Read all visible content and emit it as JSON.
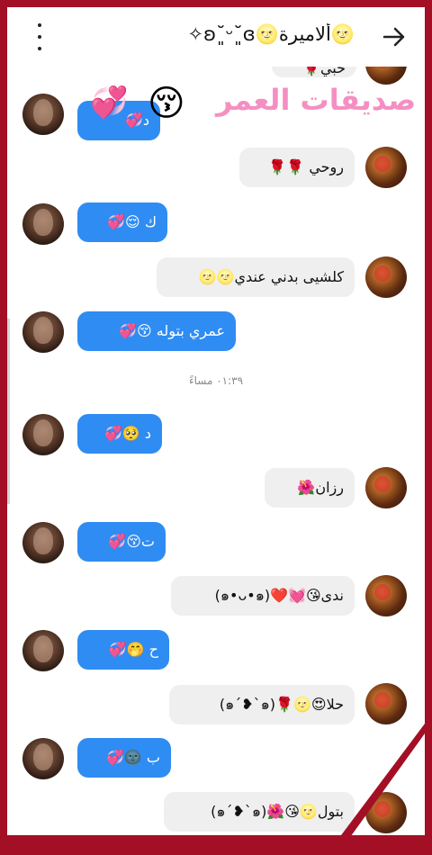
{
  "header": {
    "title": "🌝ألاميرة🌝ʚ˘͈ᵕ˘͈ɞ✧",
    "back_icon": "arrow-right-icon",
    "menu_icon": "more-vertical-icon"
  },
  "overlay": {
    "text": "صديقات العمر",
    "emoji_1": "😚",
    "emoji_2": "💞"
  },
  "messages": [
    {
      "side": "recv",
      "text": "حبي🌹"
    },
    {
      "side": "sent",
      "text": "د💞"
    },
    {
      "side": "recv",
      "text": "روحي 🌹🌹"
    },
    {
      "side": "sent",
      "text": "ك 😌💞"
    },
    {
      "side": "recv",
      "text": "كلشيى بدني عندي🌝🌝"
    },
    {
      "side": "sent",
      "text": "ع‍مري بتوله 😚💞"
    },
    {
      "side": "sent",
      "text": "د 🥺💞"
    },
    {
      "side": "recv",
      "text": "رزان🌺"
    },
    {
      "side": "sent",
      "text": "ت😚💞"
    },
    {
      "side": "recv",
      "text": "ندى😘💓❤️(๑•ᴗ•๑)"
    },
    {
      "side": "sent",
      "text": "ح 🤭💞"
    },
    {
      "side": "recv",
      "text": "حلا😍🌝🌹(๑ˊ❥ˋ๑)"
    },
    {
      "side": "sent",
      "text": "ب 🌚💞"
    },
    {
      "side": "recv",
      "text": "بتول🌝😘🌺(๑ˊ❥ˋ๑)"
    }
  ],
  "timestamp": "٠١:٣٩ مساءً",
  "colors": {
    "frame": "#a30f24",
    "sent_bubble": "#2f8cf3",
    "received_bubble": "#efefef",
    "overlay_text": "#f58fc2"
  }
}
